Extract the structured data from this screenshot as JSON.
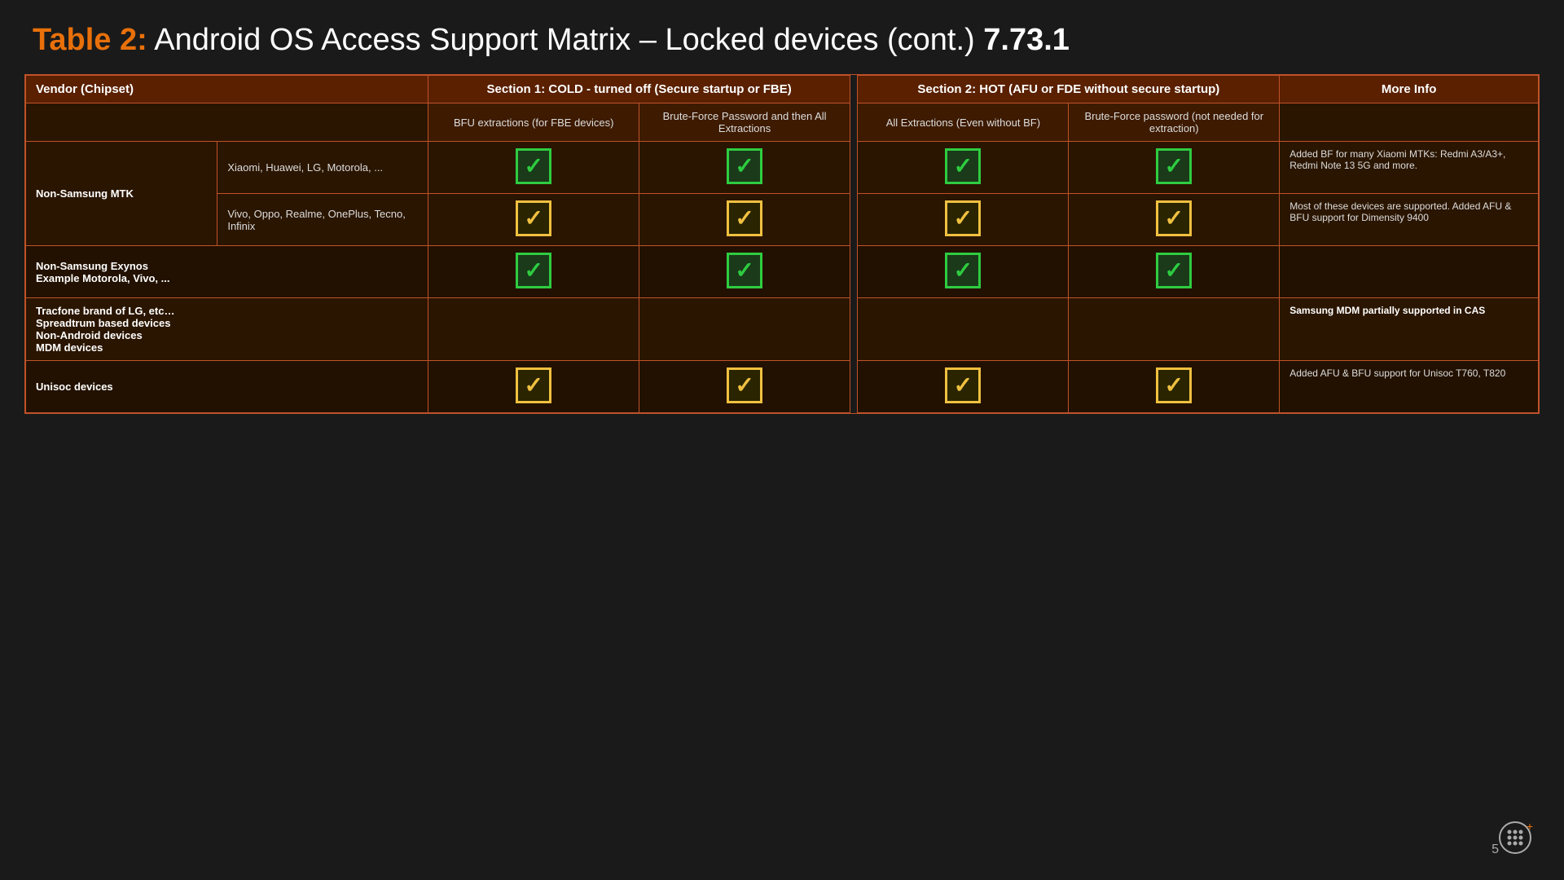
{
  "page": {
    "title_prefix": "Table 2:",
    "title_main": " Android OS Access Support Matrix – Locked devices (cont.) ",
    "title_version": "7.73.1",
    "page_number": "5"
  },
  "table": {
    "col_vendor": "Vendor (Chipset)",
    "section1_header": "Section 1: COLD  - turned off (Secure startup or FBE)",
    "section2_header": "Section 2: HOT (AFU or FDE without secure startup)",
    "more_info_header": "More Info",
    "sub_bfu": "BFU extractions (for FBE devices)",
    "sub_brute": "Brute-Force Password and then All Extractions",
    "sub_all_extractions": "All Extractions (Even without BF)",
    "sub_brute_force_hot": "Brute-Force password (not needed for extraction)",
    "rows": [
      {
        "vendor_main": "Non-Samsung MTK",
        "sub_rows": [
          {
            "sub_vendor": "Xiaomi, Huawei, LG, Motorola, ...",
            "bfu": "green",
            "brute": "green",
            "all_ext": "green",
            "brute_hot": "green",
            "more_info": "Added BF for many Xiaomi MTKs: Redmi A3/A3+, Redmi Note 13 5G and more."
          },
          {
            "sub_vendor": "Vivo, Oppo, Realme, OnePlus, Tecno, Infinix",
            "bfu": "yellow",
            "brute": "yellow",
            "all_ext": "yellow",
            "brute_hot": "yellow",
            "more_info": "Most of these devices are supported. Added AFU & BFU support for Dimensity 9400"
          }
        ]
      },
      {
        "vendor_main": "Non-Samsung Exynos\nExample Motorola, Vivo, ...",
        "sub_rows": [
          {
            "sub_vendor": "",
            "bfu": "green",
            "brute": "green",
            "all_ext": "green",
            "brute_hot": "green",
            "more_info": ""
          }
        ]
      },
      {
        "vendor_main": "Tracfone brand of LG, etc…\nSpreadtrum based devices\nNon-Android devices\nMDM devices",
        "sub_rows": [
          {
            "sub_vendor": "",
            "bfu": "none",
            "brute": "none",
            "all_ext": "none",
            "brute_hot": "none",
            "more_info_bold": "Samsung MDM partially supported in CAS",
            "more_info": ""
          }
        ]
      },
      {
        "vendor_main": "Unisoc devices",
        "sub_rows": [
          {
            "sub_vendor": "",
            "bfu": "yellow",
            "brute": "yellow",
            "all_ext": "yellow",
            "brute_hot": "yellow",
            "more_info": "Added AFU & BFU support for Unisoc T760, T820"
          }
        ]
      }
    ]
  }
}
